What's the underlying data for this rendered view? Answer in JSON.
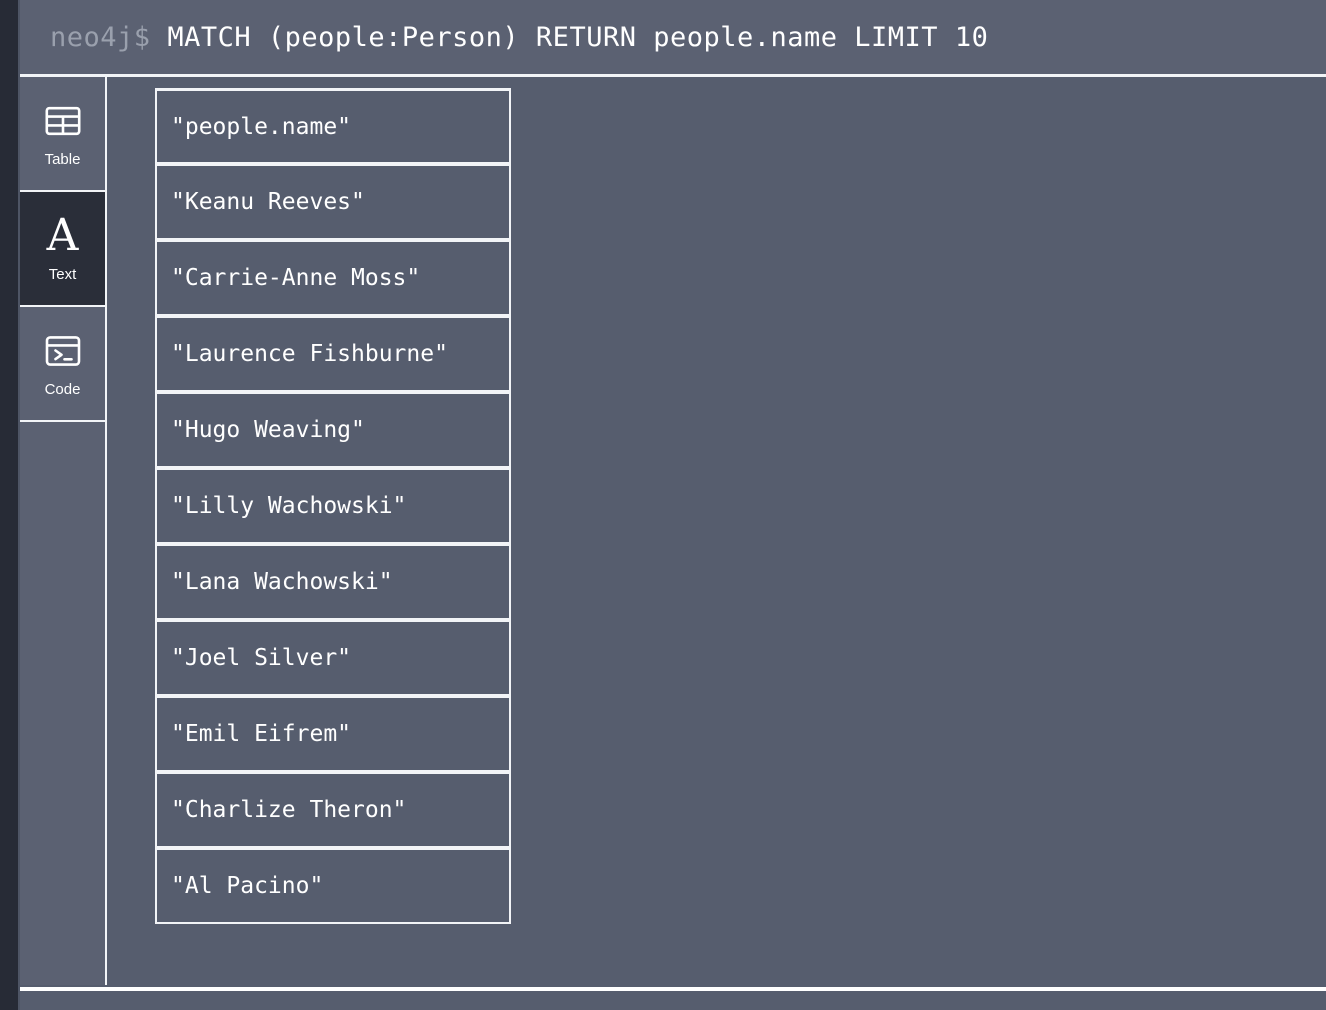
{
  "window": {
    "app": "Neo4j Browser",
    "background_color": "#565d6e",
    "rail_color": "#272b36",
    "border_color": "#f2f4f7",
    "active_tab_color": "#2a2e39"
  },
  "query_bar": {
    "prompt": "neo4j$",
    "query": "MATCH (people:Person) RETURN people.name LIMIT 10",
    "prompt_color": "#9aa0ad",
    "query_color": "#ffffff"
  },
  "view_tabs": {
    "items": [
      {
        "label": "Table",
        "icon": "table-icon",
        "active": false
      },
      {
        "label": "Text",
        "icon": "letter-a-icon",
        "active": true
      },
      {
        "label": "Code",
        "icon": "terminal-icon",
        "active": false
      }
    ]
  },
  "results": {
    "column_header": "\"people.name\"",
    "rows": [
      "\"Keanu Reeves\"",
      "\"Carrie-Anne Moss\"",
      "\"Laurence Fishburne\"",
      "\"Hugo Weaving\"",
      "\"Lilly Wachowski\"",
      "\"Lana Wachowski\"",
      "\"Joel Silver\"",
      "\"Emil Eifrem\"",
      "\"Charlize Theron\"",
      "\"Al Pacino\""
    ],
    "row_count": 10
  }
}
